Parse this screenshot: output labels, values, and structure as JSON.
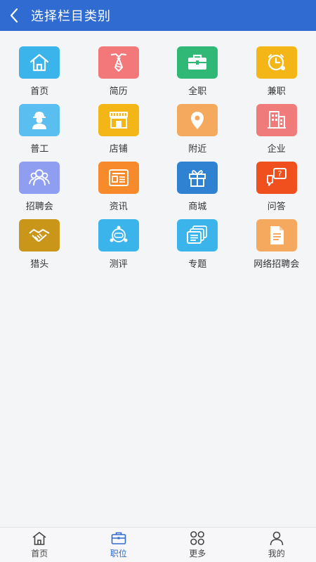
{
  "header": {
    "title": "选择栏目类别",
    "back_icon": "chevron-left-icon"
  },
  "categories": [
    {
      "label": "首页",
      "icon": "home-icon",
      "color": "#3bb4ec"
    },
    {
      "label": "简历",
      "icon": "tie-icon",
      "color": "#f2787a"
    },
    {
      "label": "全职",
      "icon": "briefcase-icon",
      "color": "#2fb876"
    },
    {
      "label": "兼职",
      "icon": "clock-icon",
      "color": "#f4b616"
    },
    {
      "label": "普工",
      "icon": "worker-icon",
      "color": "#5bbef0"
    },
    {
      "label": "店铺",
      "icon": "shop-icon",
      "color": "#f4b616"
    },
    {
      "label": "附近",
      "icon": "location-icon",
      "color": "#f5a95f"
    },
    {
      "label": "企业",
      "icon": "building-icon",
      "color": "#ef7b7b"
    },
    {
      "label": "招聘会",
      "icon": "people-icon",
      "color": "#8f9ef0"
    },
    {
      "label": "资讯",
      "icon": "news-icon",
      "color": "#f78a2a"
    },
    {
      "label": "商城",
      "icon": "gift-icon",
      "color": "#2f82d2"
    },
    {
      "label": "问答",
      "icon": "question-icon",
      "color": "#f0501e"
    },
    {
      "label": "猎头",
      "icon": "handshake-icon",
      "color": "#c9961a"
    },
    {
      "label": "测评",
      "icon": "evaluate-icon",
      "color": "#3bb4ec"
    },
    {
      "label": "专题",
      "icon": "topic-icon",
      "color": "#3bb4ec"
    },
    {
      "label": "网络招聘会",
      "icon": "document-icon",
      "color": "#f5a95f"
    }
  ],
  "bottom_nav": [
    {
      "label": "首页",
      "icon": "home-outline-icon",
      "active": false
    },
    {
      "label": "职位",
      "icon": "briefcase-outline-icon",
      "active": true
    },
    {
      "label": "更多",
      "icon": "grid-outline-icon",
      "active": false
    },
    {
      "label": "我的",
      "icon": "user-outline-icon",
      "active": false
    }
  ],
  "colors": {
    "accent": "#2f6bd0",
    "background": "#f4f5f7"
  }
}
